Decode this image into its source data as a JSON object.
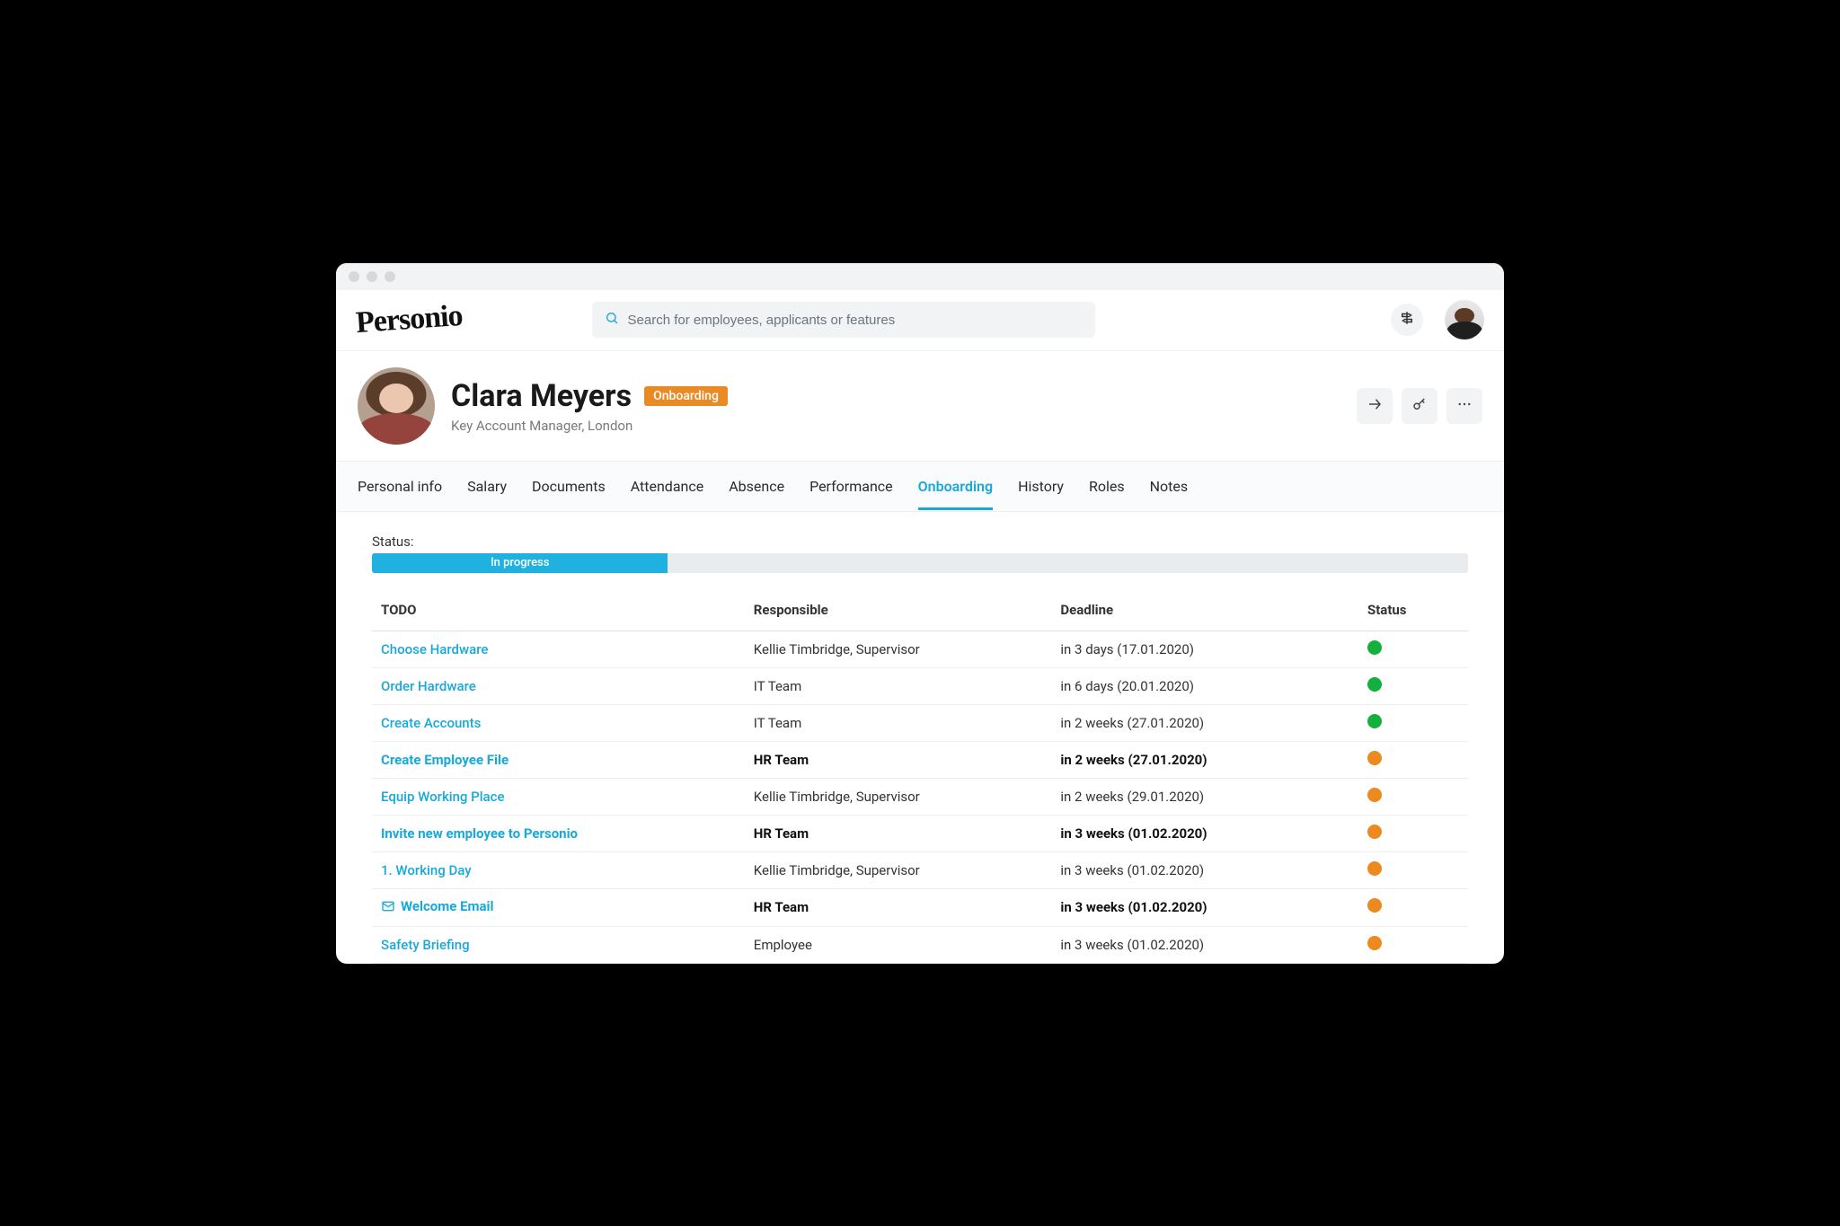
{
  "app": {
    "logo": "Personio"
  },
  "search": {
    "placeholder": "Search for employees, applicants or features"
  },
  "profile": {
    "name": "Clara Meyers",
    "badge": "Onboarding",
    "role_location": "Key Account Manager, London"
  },
  "tabs": [
    {
      "label": "Personal info",
      "active": false
    },
    {
      "label": "Salary",
      "active": false
    },
    {
      "label": "Documents",
      "active": false
    },
    {
      "label": "Attendance",
      "active": false
    },
    {
      "label": "Absence",
      "active": false
    },
    {
      "label": "Performance",
      "active": false
    },
    {
      "label": "Onboarding",
      "active": true
    },
    {
      "label": "History",
      "active": false
    },
    {
      "label": "Roles",
      "active": false
    },
    {
      "label": "Notes",
      "active": false
    }
  ],
  "status": {
    "label": "Status:",
    "progress_text": "In progress",
    "progress_percent": 27
  },
  "columns": {
    "todo": "TODO",
    "responsible": "Responsible",
    "deadline": "Deadline",
    "status": "Status"
  },
  "rows": [
    {
      "todo": "Choose Hardware",
      "responsible": "Kellie Timbridge, Supervisor",
      "deadline": "in 3 days (17.01.2020)",
      "status": "green",
      "bold": false,
      "icon": null
    },
    {
      "todo": "Order Hardware",
      "responsible": "IT Team",
      "deadline": "in 6 days (20.01.2020)",
      "status": "green",
      "bold": false,
      "icon": null
    },
    {
      "todo": "Create Accounts",
      "responsible": "IT Team",
      "deadline": "in 2 weeks (27.01.2020)",
      "status": "green",
      "bold": false,
      "icon": null
    },
    {
      "todo": "Create Employee File",
      "responsible": "HR Team",
      "deadline": "in 2 weeks (27.01.2020)",
      "status": "orange",
      "bold": true,
      "icon": null
    },
    {
      "todo": "Equip Working Place",
      "responsible": "Kellie Timbridge, Supervisor",
      "deadline": "in 2 weeks (29.01.2020)",
      "status": "orange",
      "bold": false,
      "icon": null
    },
    {
      "todo": "Invite new employee to Personio",
      "responsible": "HR Team",
      "deadline": "in 3 weeks (01.02.2020)",
      "status": "orange",
      "bold": true,
      "icon": null
    },
    {
      "todo": "1. Working Day",
      "responsible": "Kellie Timbridge, Supervisor",
      "deadline": "in 3 weeks (01.02.2020)",
      "status": "orange",
      "bold": false,
      "icon": null
    },
    {
      "todo": "Welcome Email",
      "responsible": "HR Team",
      "deadline": "in 3 weeks (01.02.2020)",
      "status": "orange",
      "bold": true,
      "icon": "mail"
    },
    {
      "todo": "Safety Briefing",
      "responsible": "Employee",
      "deadline": "in 3 weeks (01.02.2020)",
      "status": "orange",
      "bold": false,
      "icon": null
    }
  ]
}
